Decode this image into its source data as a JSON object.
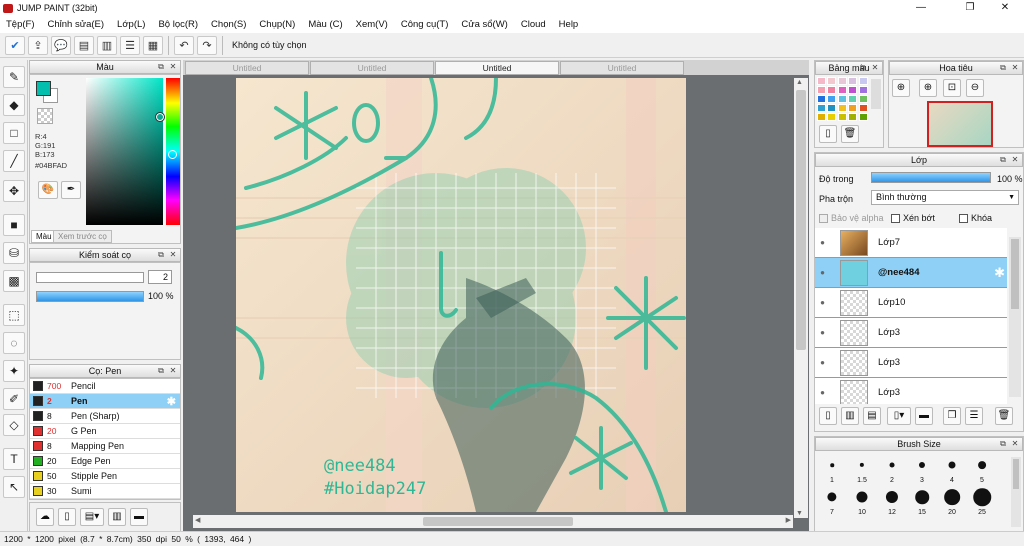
{
  "window": {
    "title": "JUMP PAINT (32bit)"
  },
  "menu": [
    "Tệp(F)",
    "Chỉnh sửa(E)",
    "Lớp(L)",
    "Bộ lọc(R)",
    "Chọn(S)",
    "Chụp(N)",
    "Màu (C)",
    "Xem(V)",
    "Công cụ(T)",
    "Cửa sổ(W)",
    "Cloud",
    "Help"
  ],
  "toolbar": {
    "selection_status": "Không có tùy chọn"
  },
  "color_panel": {
    "title": "Màu",
    "r": "R:4",
    "g": "G:191",
    "b": "B:173",
    "hex": "#04BFAD",
    "main_color": "#04bfad",
    "tab_color": "Màu",
    "tab_preview": "Xem trước cọ"
  },
  "brush_control": {
    "title": "Kiểm soát cọ",
    "size": "2",
    "opacity": "100 %",
    "opacity_fraction": 1.0
  },
  "brush_list": {
    "title": "Cọ: Pen",
    "items": [
      {
        "size": "700",
        "name": "Pencil",
        "color": "#222222",
        "sizecolor": "#e03030"
      },
      {
        "size": "2",
        "name": "Pen",
        "color": "#222222",
        "sizecolor": "#e03030",
        "selected": true
      },
      {
        "size": "8",
        "name": "Pen (Sharp)",
        "color": "#222222",
        "sizecolor": "#111111"
      },
      {
        "size": "20",
        "name": "G Pen",
        "color": "#e03030",
        "sizecolor": "#e03030"
      },
      {
        "size": "8",
        "name": "Mapping Pen",
        "color": "#e03030",
        "sizecolor": "#111111"
      },
      {
        "size": "20",
        "name": "Edge Pen",
        "color": "#22b022",
        "sizecolor": "#111111"
      },
      {
        "size": "50",
        "name": "Stipple Pen",
        "color": "#e8d020",
        "sizecolor": "#111111"
      },
      {
        "size": "30",
        "name": "Sumi",
        "color": "#e8d020",
        "sizecolor": "#111111"
      }
    ]
  },
  "doc_tabs": [
    "Untitled",
    "Untitled",
    "Untitled",
    "Untitled"
  ],
  "artwork": {
    "watermark_1": "@nee484",
    "watermark_2": "#Hoidap247"
  },
  "palette_panel": {
    "title": "Bảng màu",
    "colors": [
      "#f5b8c8",
      "#f3c9cf",
      "#e8c8d6",
      "#d8c0e0",
      "#c8c8f0",
      "#f5a0b0",
      "#f080a0",
      "#e060c0",
      "#c050d0",
      "#a070e0",
      "#2070e0",
      "#40a0f0",
      "#60c0e0",
      "#60d0b0",
      "#70c060",
      "#30a0d0",
      "#2090c0",
      "#f0c020",
      "#f0a020",
      "#e05020",
      "#e0b000",
      "#e8d000",
      "#c8c000",
      "#a0b000",
      "#60a000"
    ]
  },
  "navigator": {
    "title": "Hoa tiêu"
  },
  "layer_panel": {
    "title": "Lớp",
    "opacity_label": "Độ trong",
    "opacity_value": "100 %",
    "opacity_fraction": 1.0,
    "blend_label": "Pha trộn",
    "blend_value": "Bình thường",
    "protect_alpha": "Bảo vệ alpha",
    "clip": "Xén bớt",
    "lock": "Khóa",
    "layers": [
      {
        "name": "Lớp7"
      },
      {
        "name": "@nee484",
        "selected": true
      },
      {
        "name": "Lớp10"
      },
      {
        "name": "Lớp3"
      },
      {
        "name": "Lớp3"
      },
      {
        "name": "Lớp3"
      }
    ]
  },
  "brush_size_panel": {
    "title": "Brush Size",
    "sizes": [
      "1",
      "1.5",
      "2",
      "3",
      "4",
      "5",
      "7",
      "10",
      "12",
      "15",
      "20",
      "25"
    ]
  },
  "status": {
    "dimensions": "1200 * 1200 pixel",
    "physical": "(8.7 * 8.7cm)",
    "dpi": "350 dpi",
    "zoom": "50 %",
    "coords": "( 1393, 464 )"
  }
}
